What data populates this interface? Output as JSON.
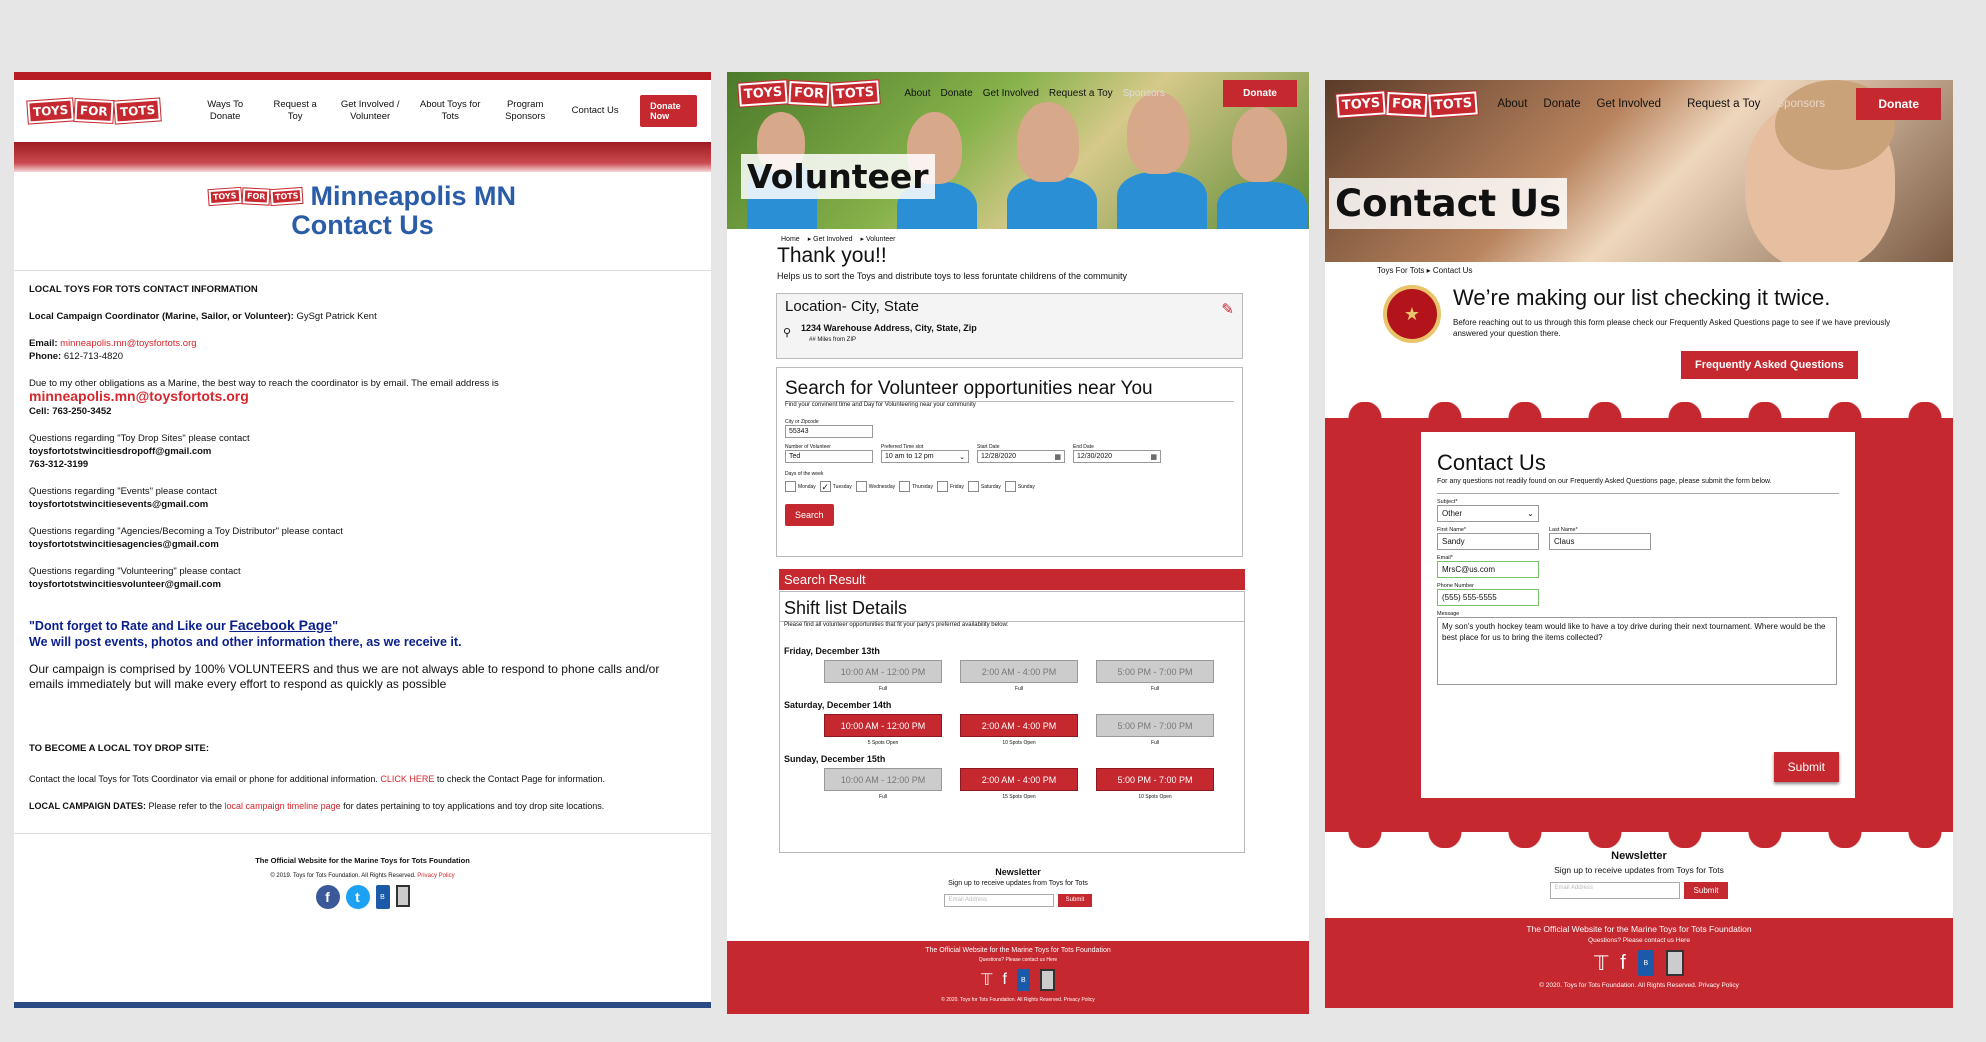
{
  "p1": {
    "logo": [
      "TOYS",
      "FOR",
      "TOTS"
    ],
    "menu": [
      "Ways To Donate",
      "Request a Toy",
      "Get Involved / Volunteer",
      "About Toys for Tots",
      "Program Sponsors",
      "Contact Us"
    ],
    "donate": "Donate Now",
    "title1": "Minneapolis MN",
    "title2": "Contact Us",
    "heading_contact": "LOCAL TOYS FOR TOTS CONTACT INFORMATION",
    "coord_label": "Local Campaign Coordinator (Marine, Sailor, or Volunteer):",
    "coord_name": " GySgt Patrick Kent",
    "email_label": "Email:",
    "email": " minneapolis.mn@toysfortots.org",
    "phone_label": "Phone:",
    "phone": " 612-713-4820",
    "oblig": "Due to my other obligations as a Marine, the best way to reach the coordinator is by email. The email address is",
    "email_big": "minneapolis.mn@toysfortots.org",
    "cell": "Cell: 763-250-3452",
    "q1": "Questions regarding \"Toy Drop Sites\" please contact",
    "q1_email": "toysfortotstwincitiesdropoff@gmail.com",
    "q1_phone": "763-312-3199",
    "q2": "Questions regarding \"Events\" please contact",
    "q2_email": "toysfortotstwincitiesevents@gmail.com",
    "q3": "Questions regarding \"Agencies/Becoming a Toy Distributor\" please contact",
    "q3_email": "toysfortotstwincitiesagencies@gmail.com",
    "q4": "Questions regarding \"Volunteering\" please contact",
    "q4_email": "toysfortotstwincitiesvolunteer@gmail.com",
    "fb_pre": "\"Dont forget to Rate and Like our ",
    "fb_link": "Facebook Page",
    "fb_post": "\"",
    "fb_line2": "We will post events, photos and other information there, as we receive it.",
    "campaign": "Our campaign is comprised by 100% VOLUNTEERS and thus we are not always able to respond to phone calls and/or emails immediately but will make every effort to respond as quickly as possible",
    "drop_heading": "TO BECOME A LOCAL TOY DROP SITE:",
    "drop_text": "Contact the local Toys for Tots Coordinator via email or phone for additional information. ",
    "click_here": "CLICK HERE",
    "drop_text2": " to check the Contact Page for information.",
    "dates_label": "LOCAL CAMPAIGN DATES:",
    "dates_text": " Please refer to the ",
    "dates_link": "local campaign timeline page",
    "dates_text2": " for dates pertaining to toy applications and toy drop site locations.",
    "foot_title": "The Official Website for the Marine Toys for Tots Foundation",
    "foot_copy": "© 2019. Toys for Tots Foundation. All Rights Reserved. ",
    "privacy": "Privacy Policy"
  },
  "p2": {
    "nav": [
      "About",
      "Donate",
      "Get Involved",
      "Request a Toy",
      "Sponsors"
    ],
    "donate": "Donate",
    "title": "Volunteer",
    "crumbs": [
      "Home",
      "Get Involved",
      "Volunteer"
    ],
    "thanks": "Thank you!!",
    "sub": "Helps us to sort the Toys and distribute toys to less foruntate  childrens of the community",
    "loc_title": "Location- City, State",
    "loc_addr": "1234 Warehouse Address, City, State, Zip",
    "loc_miles": "## Miles from ZIP",
    "search_title": "Search for Volunteer opportunities near You",
    "search_sub": "Find your convinent time and Day for Volunteering  near your community",
    "zip_label": "City or Zipcode",
    "zip_value": "55343",
    "num_label": "Number of Volunteer",
    "num_value": "Ted",
    "time_label": "Preferred Time slot",
    "time_value": "10 am to 12 pm",
    "start_label": "Start Date",
    "start_value": "12/28/2020",
    "end_label": "End Date",
    "end_value": "12/30/2020",
    "days_label": "Days of the week",
    "days": [
      "Monday",
      "Tuesday",
      "Wednesday",
      "Thursday",
      "Friday",
      "Saturday",
      "Sunday"
    ],
    "search_btn": "Search",
    "result": "Search Result",
    "shift_title": "Shift list Details",
    "shift_sub": "Please find all volunteer opportunities that fit your party's preferred availability below:",
    "days_list": [
      {
        "label": "Friday, December 13th",
        "slots": [
          {
            "time": "10:00 AM - 12:00 PM",
            "note": "Full",
            "open": false
          },
          {
            "time": "2:00 AM - 4:00 PM",
            "note": "Full",
            "open": false
          },
          {
            "time": "5:00 PM - 7:00 PM",
            "note": "Full",
            "open": false
          }
        ]
      },
      {
        "label": "Saturday, December 14th",
        "slots": [
          {
            "time": "10:00 AM - 12:00 PM",
            "note": "5 Spots Open",
            "open": true
          },
          {
            "time": "2:00 AM - 4:00 PM",
            "note": "10 Spots Open",
            "open": true
          },
          {
            "time": "5:00 PM - 7:00 PM",
            "note": "Full",
            "open": false
          }
        ]
      },
      {
        "label": "Sunday, December 15th",
        "slots": [
          {
            "time": "10:00 AM - 12:00 PM",
            "note": "Full",
            "open": false
          },
          {
            "time": "2:00 AM - 4:00 PM",
            "note": "15 Spots Open",
            "open": true
          },
          {
            "time": "5:00 PM - 7:00 PM",
            "note": "10 Spots Open",
            "open": true
          }
        ]
      }
    ],
    "news_title": "Newsletter",
    "news_sub": "Sign up to receive updates from Toys for Tots",
    "news_placeholder": "Email Address",
    "news_btn": "Submit",
    "foot_title": "The Official Website for the Marine Toys for Tots Foundation",
    "foot_q": "Questions? Please contact us Here",
    "foot_copy": "© 2020. Toys for Tots Foundation. All Rights Reserved. Privacy Policy"
  },
  "p3": {
    "nav": [
      "About",
      "Donate",
      "Get Involved",
      "Request a Toy",
      "Sponsors"
    ],
    "donate": "Donate",
    "title": "Contact Us",
    "crumbs": [
      "Toys For Tots",
      "Contact Us"
    ],
    "mk_title": "We’re making our list checking it twice.",
    "mk_sub": "Before reaching out to us through this form please check our Frequently Asked Questions page to see if we have previously answered your question there.",
    "faq_btn": "Frequently Asked Questions",
    "form_title": "Contact Us",
    "form_sub": "For any questions not readily found on our Frequently Asked Questions page, please submit the form below.",
    "subject_label": "Subject*",
    "subject_value": "Other",
    "first_label": "First Name*",
    "first_value": "Sandy",
    "last_label": "Last Name*",
    "last_value": "Claus",
    "email_label": "Email*",
    "email_value": "MrsC@us.com",
    "phone_label": "Phone Number",
    "phone_value": "(555) 555-5555",
    "msg_label": "Message",
    "msg_value": "My son's youth hockey team would like to have a toy drive during their next tournament. Where would be the best place for us to bring the items collected?",
    "submit": "Submit",
    "news_title": "Newsletter",
    "news_sub": "Sign up to receive updates from Toys for Tots",
    "news_placeholder": "Email Address",
    "news_btn": "Submit",
    "foot_title": "The Official Website for the Marine Toys for Tots Foundation",
    "foot_q": "Questions? Please contact us Here",
    "foot_copy": "© 2020. Toys for Tots Foundation. All Rights Reserved. Privacy Policy"
  },
  "colors": {
    "brand_red": "#c5282f",
    "title_blue": "#2a5ca8",
    "footer_navy": "#2a4a86"
  },
  "icons": [
    "facebook-icon",
    "twitter-icon",
    "bbb-icon",
    "badge-icon",
    "pin-icon",
    "pencil-icon",
    "calendar-icon",
    "chevron-down-icon"
  ]
}
